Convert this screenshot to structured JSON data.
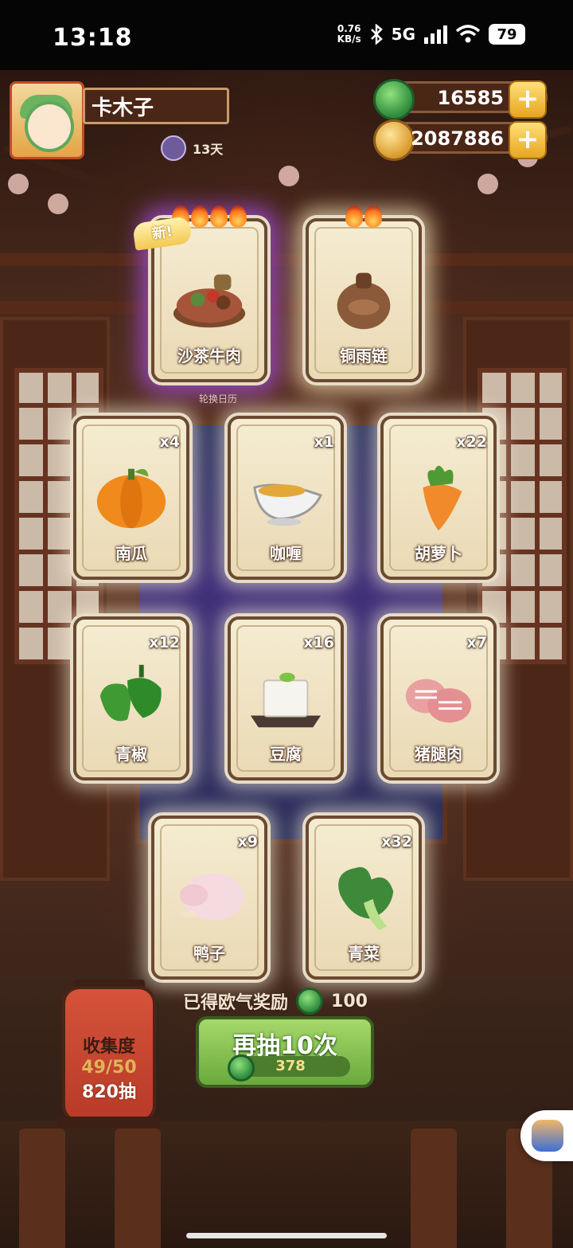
{
  "status_bar": {
    "time": "13:18",
    "net_speed_value": "0.76",
    "net_speed_unit": "KB/s",
    "network": "5G",
    "battery": "79"
  },
  "player": {
    "name": "卡木子",
    "days": "13天"
  },
  "currency": {
    "jade_amount": "16585",
    "gold_amount": "2087886",
    "plus_symbol": "+"
  },
  "featured_cards": [
    {
      "label": "沙茶牛肉",
      "flames": 4,
      "new_tag": "新!",
      "art": "bowl-dish-icon"
    },
    {
      "label": "铜雨链",
      "flames": 2,
      "art": "bronze-bell-icon"
    }
  ],
  "calendar_tip": "轮换日历",
  "item_cards": [
    {
      "label": "南瓜",
      "count": "x4",
      "art": "pumpkin-icon"
    },
    {
      "label": "咖喱",
      "count": "x1",
      "art": "curry-sauce-icon"
    },
    {
      "label": "胡萝卜",
      "count": "x22",
      "art": "carrot-icon"
    },
    {
      "label": "青椒",
      "count": "x12",
      "art": "green-pepper-icon"
    },
    {
      "label": "豆腐",
      "count": "x16",
      "art": "tofu-icon"
    },
    {
      "label": "猪腿肉",
      "count": "x7",
      "art": "pork-leg-icon"
    },
    {
      "label": "鸭子",
      "count": "x9",
      "art": "duck-icon"
    },
    {
      "label": "青菜",
      "count": "x32",
      "art": "bok-choy-icon"
    }
  ],
  "reward": {
    "text": "已得欧气奖励",
    "amount": "100"
  },
  "collection": {
    "title": "收集度",
    "progress": "49/50",
    "draws": "820抽"
  },
  "draw_button": {
    "label": "再抽10次",
    "cost": "378"
  },
  "colors": {
    "jade": "#2e8b3c",
    "gold": "#d99a2b",
    "button_green": "#69a93c",
    "card_bg": "#f5ecd2"
  }
}
